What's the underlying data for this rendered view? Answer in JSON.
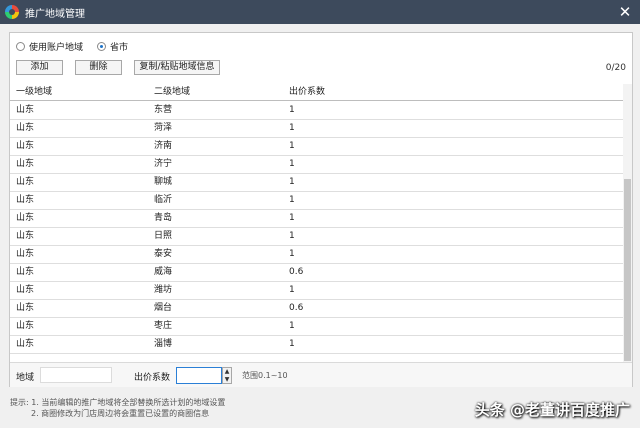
{
  "window": {
    "title": "推广地域管理"
  },
  "radios": [
    {
      "label": "使用账户地域",
      "checked": false
    },
    {
      "label": "省市",
      "checked": true
    }
  ],
  "toolbar": {
    "add_label": "添加",
    "delete_label": "删除",
    "copy_label": "复制/粘贴地域信息",
    "count": "0/20"
  },
  "table": {
    "headers": [
      "一级地域",
      "二级地域",
      "出价系数"
    ],
    "rows": [
      [
        "山东",
        "东营",
        "1"
      ],
      [
        "山东",
        "菏泽",
        "1"
      ],
      [
        "山东",
        "济南",
        "1"
      ],
      [
        "山东",
        "济宁",
        "1"
      ],
      [
        "山东",
        "聊城",
        "1"
      ],
      [
        "山东",
        "临沂",
        "1"
      ],
      [
        "山东",
        "青岛",
        "1"
      ],
      [
        "山东",
        "日照",
        "1"
      ],
      [
        "山东",
        "泰安",
        "1"
      ],
      [
        "山东",
        "威海",
        "0.6"
      ],
      [
        "山东",
        "潍坊",
        "1"
      ],
      [
        "山东",
        "烟台",
        "0.6"
      ],
      [
        "山东",
        "枣庄",
        "1"
      ],
      [
        "山东",
        "淄博",
        "1"
      ]
    ]
  },
  "footer": {
    "region_label": "地域",
    "region_value": "",
    "coef_label": "出价系数",
    "coef_value": "",
    "range_hint": "范围0.1~10"
  },
  "tips": {
    "line1": "提示: 1. 当前编辑的推广地域将全部替换所选计划的地域设置",
    "line2": "2. 商圈修改为门店周边将会重置已设置的商圈信息"
  },
  "watermark": "头条 @老董讲百度推广",
  "icons": {
    "app": "app-logo-icon",
    "close": "close-icon"
  }
}
